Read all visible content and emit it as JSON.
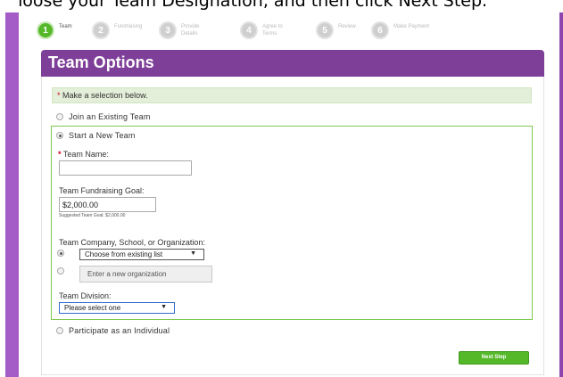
{
  "caption": "Choose your Team Designation, and then click Next Step.",
  "steps": [
    {
      "num": "1",
      "label": "Team"
    },
    {
      "num": "2",
      "label": "Fundraising"
    },
    {
      "num": "3",
      "label": "Provide Details"
    },
    {
      "num": "4",
      "label": "Agree to Terms"
    },
    {
      "num": "5",
      "label": "Review"
    },
    {
      "num": "6",
      "label": "Make Payment"
    }
  ],
  "header": {
    "title": "Team Options"
  },
  "notice": {
    "star": "*",
    "text": "Make a selection below."
  },
  "options": {
    "join": "Join an Existing Team",
    "start": "Start a New Team",
    "individual": "Participate as an Individual"
  },
  "form": {
    "team_name_star": "*",
    "team_name_label": "Team Name:",
    "team_name_value": "",
    "goal_label": "Team Fundraising Goal:",
    "goal_value": "$2,000.00",
    "goal_hint": "Suggested Team Goal: $2,000.00",
    "org_label": "Team Company, School, or Organization:",
    "org_select": "Choose from existing list",
    "org_new_placeholder": "Enter a new organization",
    "division_label": "Team Division:",
    "division_select": "Please select one"
  },
  "buttons": {
    "next": "Next Step"
  },
  "colors": {
    "brand_purple": "#7e3f98",
    "accent_green": "#54b829"
  }
}
